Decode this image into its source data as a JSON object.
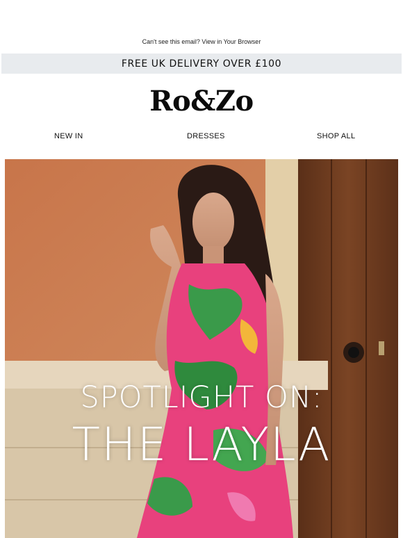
{
  "preheader": {
    "text": "Can't see this email? View in Your Browser"
  },
  "promo": {
    "text": "FREE UK DELIVERY OVER £100"
  },
  "brand": {
    "logo_text": "Ro&Zo"
  },
  "nav": {
    "items": [
      {
        "label": "NEW IN"
      },
      {
        "label": "DRESSES"
      },
      {
        "label": "SHOP ALL"
      }
    ]
  },
  "hero": {
    "line1": "SPOTLIGHT ON:",
    "line2": "THE LAYLA"
  },
  "colors": {
    "promo_bg": "#e8ebee",
    "wall": "#c97a4e",
    "door": "#6b3a1f",
    "print_pink": "#e8417d",
    "print_green": "#3a9a4a"
  }
}
